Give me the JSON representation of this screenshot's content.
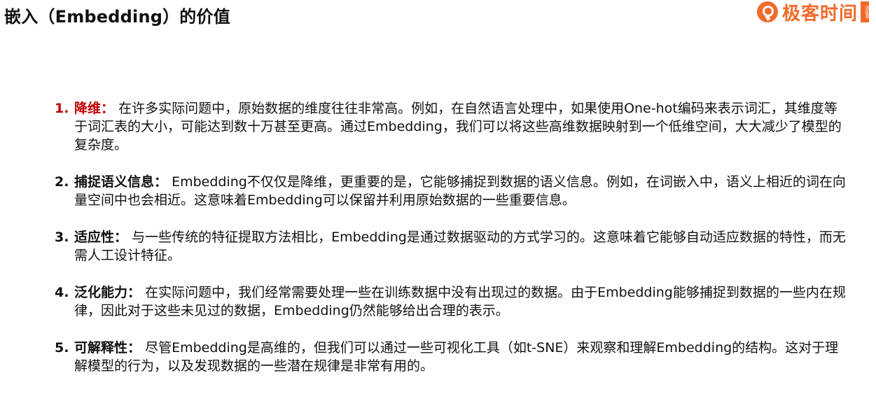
{
  "title": "嵌入（Embedding）的价值",
  "logo": {
    "icon": "geekbang-logo-icon",
    "text": "极客时间",
    "badge": "训练营",
    "color": "#f06a2a"
  },
  "items": [
    {
      "num": "1.",
      "head": "降维：",
      "body": "在许多实际问题中，原始数据的维度往往非常高。例如，在自然语言处理中，如果使用One-hot编码来表示词汇，其维度等于词汇表的大小，可能达到数十万甚至更高。通过Embedding，我们可以将这些高维数据映射到一个低维空间，大大减少了模型的复杂度。",
      "highlight": true
    },
    {
      "num": "2.",
      "head": "捕捉语义信息：",
      "body": "Embedding不仅仅是降维，更重要的是，它能够捕捉到数据的语义信息。例如，在词嵌入中，语义上相近的词在向量空间中也会相近。这意味着Embedding可以保留并利用原始数据的一些重要信息。"
    },
    {
      "num": "3.",
      "head": "适应性：",
      "body": "与一些传统的特征提取方法相比，Embedding是通过数据驱动的方式学习的。这意味着它能够自动适应数据的特性，而无需人工设计特征。"
    },
    {
      "num": "4.",
      "head": "泛化能力：",
      "body": "在实际问题中，我们经常需要处理一些在训练数据中没有出现过的数据。由于Embedding能够捕捉到数据的一些内在规律，因此对于这些未见过的数据，Embedding仍然能够给出合理的表示。"
    },
    {
      "num": "5.",
      "head": "可解释性：",
      "body": "尽管Embedding是高维的，但我们可以通过一些可视化工具（如t-SNE）来观察和理解Embedding的结构。这对于理解模型的行为，以及发现数据的一些潜在规律是非常有用的。"
    }
  ]
}
